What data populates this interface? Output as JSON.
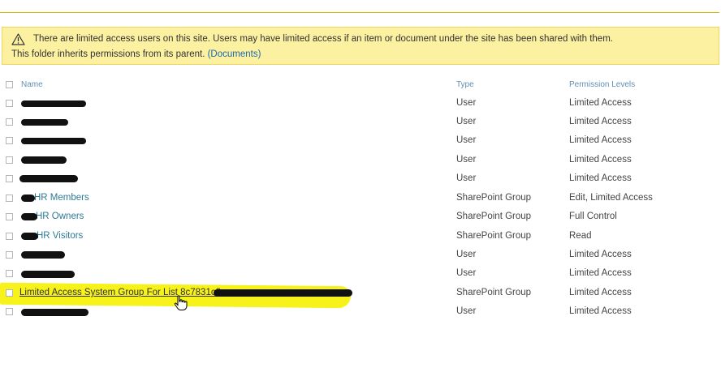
{
  "banner": {
    "line1": "There are limited access users on this site. Users may have limited access if an item or document under the site has been shared with them.",
    "line2_prefix": "This folder inherits permissions from its parent.",
    "line2_link": "(Documents)"
  },
  "table": {
    "headers": {
      "name": "Name",
      "type": "Type",
      "permissions": "Permission Levels"
    },
    "rows": [
      {
        "name": "",
        "type": "User",
        "permissions": "Limited Access"
      },
      {
        "name": "",
        "type": "User",
        "permissions": "Limited Access"
      },
      {
        "name": "",
        "type": "User",
        "permissions": "Limited Access"
      },
      {
        "name": "",
        "type": "User",
        "permissions": "Limited Access"
      },
      {
        "name": "",
        "type": "User",
        "permissions": "Limited Access"
      },
      {
        "name": "HR Members",
        "type": "SharePoint Group",
        "permissions": "Edit, Limited Access"
      },
      {
        "name": "HR Owners",
        "type": "SharePoint Group",
        "permissions": "Full Control"
      },
      {
        "name": "HR Visitors",
        "type": "SharePoint Group",
        "permissions": "Read"
      },
      {
        "name": "",
        "type": "User",
        "permissions": "Limited Access"
      },
      {
        "name": "",
        "type": "User",
        "permissions": "Limited Access"
      },
      {
        "name": "Limited Access System Group For List 8c7831c2-",
        "type": "SharePoint Group",
        "permissions": "Limited Access"
      },
      {
        "name": "",
        "type": "User",
        "permissions": "Limited Access"
      }
    ]
  },
  "colors": {
    "highlight": "#f6f21a",
    "banner_bg": "#fcf0a1",
    "link": "#2d7a96",
    "redaction": "#111111"
  },
  "icons": {
    "banner": "warning-triangle-icon",
    "pointer": "hand-pointer-icon"
  }
}
